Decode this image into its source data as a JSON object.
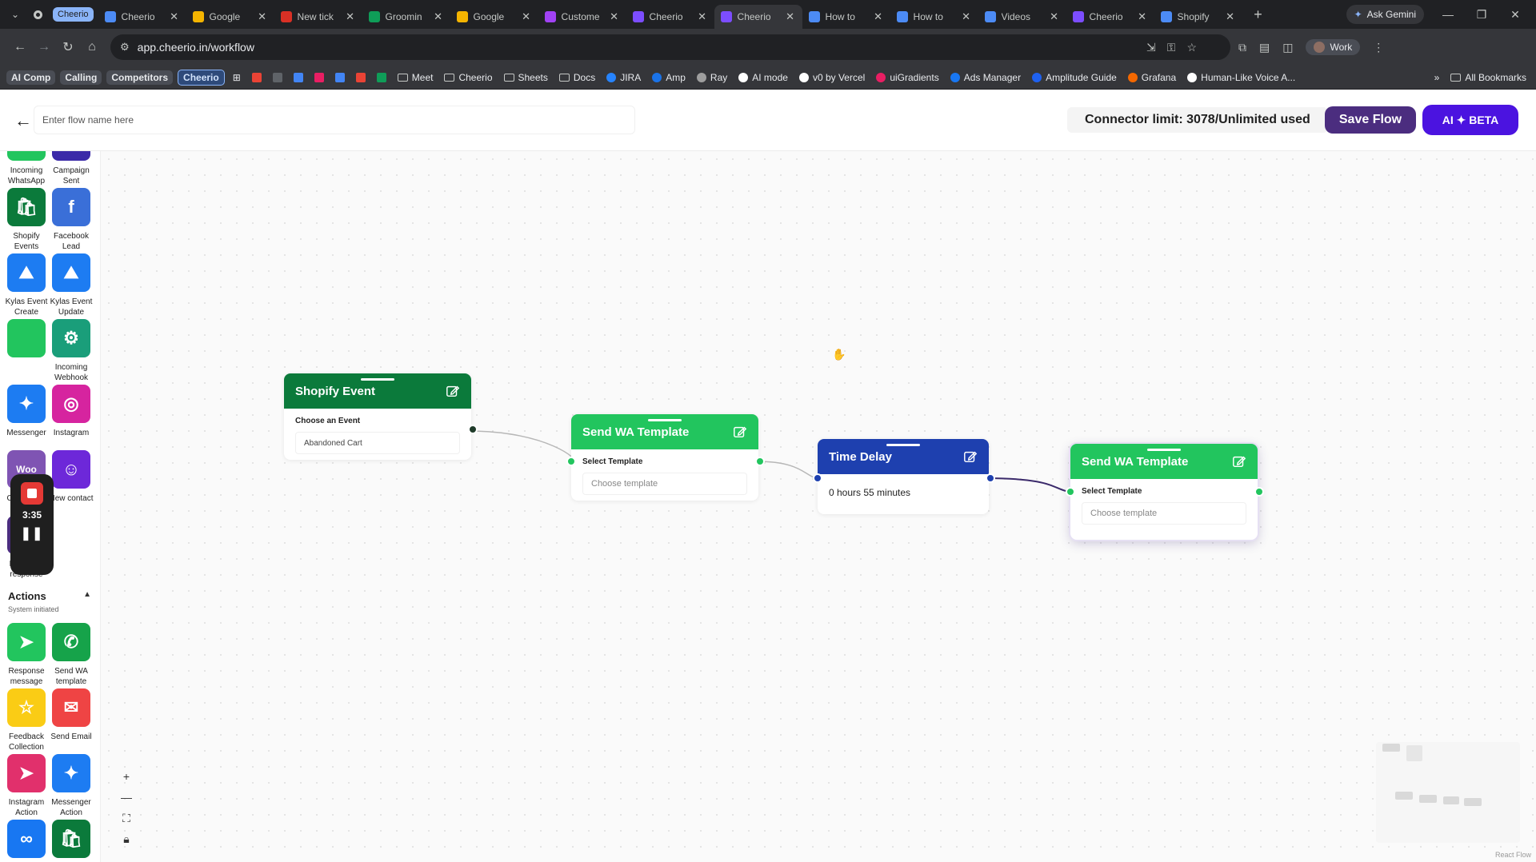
{
  "browser": {
    "group_label": "Cheerio",
    "tabs": [
      {
        "title": "Cheerio",
        "color": "#4c8bf5"
      },
      {
        "title": "Google",
        "color": "#f4b400"
      },
      {
        "title": "New tick",
        "color": "#d93025"
      },
      {
        "title": "Groomin",
        "color": "#0f9d58"
      },
      {
        "title": "Google",
        "color": "#f4b400"
      },
      {
        "title": "Custome",
        "color": "#a142f4"
      },
      {
        "title": "Cheerio",
        "color": "#7c4dff"
      },
      {
        "title": "Cheerio",
        "color": "#7c4dff"
      },
      {
        "title": "How to",
        "color": "#4c8bf5"
      },
      {
        "title": "How to",
        "color": "#4c8bf5"
      },
      {
        "title": "Videos",
        "color": "#4c8bf5"
      },
      {
        "title": "Cheerio",
        "color": "#7c4dff"
      },
      {
        "title": "Shopify",
        "color": "#4c8bf5"
      }
    ],
    "ask_gemini": "Ask Gemini",
    "url": "app.cheerio.in/workflow",
    "profile": "Work",
    "bookmarks": [
      {
        "label": "AI Comp",
        "kind": "chip"
      },
      {
        "label": "Calling",
        "kind": "chip"
      },
      {
        "label": "Competitors",
        "kind": "chip"
      },
      {
        "label": "Cheerio",
        "kind": "chip-blue"
      },
      {
        "label": "",
        "kind": "apps"
      },
      {
        "label": "",
        "kind": "icon",
        "color": "#ea4335"
      },
      {
        "label": "",
        "kind": "icon",
        "color": "#5f6368"
      },
      {
        "label": "",
        "kind": "icon",
        "color": "#4285f4"
      },
      {
        "label": "",
        "kind": "icon",
        "color": "#e91e63"
      },
      {
        "label": "",
        "kind": "icon",
        "color": "#4285f4"
      },
      {
        "label": "",
        "kind": "icon",
        "color": "#ea4335"
      },
      {
        "label": "",
        "kind": "icon",
        "color": "#0f9d58"
      },
      {
        "label": "Meet",
        "kind": "folder"
      },
      {
        "label": "Cheerio",
        "kind": "folder"
      },
      {
        "label": "Sheets",
        "kind": "folder"
      },
      {
        "label": "Docs",
        "kind": "folder"
      },
      {
        "label": "JIRA",
        "kind": "link",
        "color": "#2684ff"
      },
      {
        "label": "Amp",
        "kind": "link",
        "color": "#1a73e8"
      },
      {
        "label": "Ray",
        "kind": "link",
        "color": "#9e9e9e"
      },
      {
        "label": "AI mode",
        "kind": "link",
        "color": "#ffffff"
      },
      {
        "label": "v0 by Vercel",
        "kind": "link",
        "color": "#ffffff"
      },
      {
        "label": "uiGradients",
        "kind": "link",
        "color": "#e91e63"
      },
      {
        "label": "Ads Manager",
        "kind": "link",
        "color": "#1877f2"
      },
      {
        "label": "Amplitude Guide",
        "kind": "link",
        "color": "#1e61f0"
      },
      {
        "label": "Grafana",
        "kind": "link",
        "color": "#f46800"
      },
      {
        "label": "Human-Like Voice A...",
        "kind": "link",
        "color": "#ffffff"
      }
    ],
    "all_bookmarks": "All Bookmarks"
  },
  "header": {
    "flow_name_placeholder": "Enter flow name here",
    "connector_limit": "Connector limit: 3078/Unlimited used",
    "save_label": "Save Flow",
    "ai_label": "AI ✦ BETA"
  },
  "sidebar": {
    "triggers": [
      {
        "label": "Incoming WhatsApp",
        "icon": "whatsapp-icon",
        "color": "#22c55e"
      },
      {
        "label": "Campaign Sent",
        "icon": "campaign-icon",
        "color": "#3b2aa8"
      },
      {
        "label": "Shopify Events",
        "icon": "shopify-icon",
        "color": "#0b7a3b"
      },
      {
        "label": "Facebook Lead",
        "icon": "facebook-icon",
        "color": "#3a6fd8"
      },
      {
        "label": "Kylas Event Create",
        "icon": "kylas-icon",
        "color": "#1d7cf2"
      },
      {
        "label": "Kylas Event Update",
        "icon": "kylas-icon",
        "color": "#1d7cf2"
      },
      {
        "label": "",
        "icon": "hidden-icon",
        "color": "#22c55e"
      },
      {
        "label": "Incoming Webhook",
        "icon": "webhook-icon",
        "color": "#1a9e7a"
      },
      {
        "label": "Messenger",
        "icon": "messenger-icon",
        "color": "#1d7cf2"
      },
      {
        "label": "Instagram",
        "icon": "instagram-icon",
        "color": "#d6249f"
      },
      {
        "label": "Commerce Event",
        "icon": "woo-icon",
        "color": "#7f54b3"
      },
      {
        "label": "New contact",
        "icon": "contact-icon",
        "color": "#6d28d9"
      },
      {
        "label": "New form response",
        "icon": "form-icon",
        "color": "#4b2d7f"
      }
    ],
    "actions_title": "Actions",
    "actions_subtitle": "System initiated",
    "actions": [
      {
        "label": "Response message",
        "icon": "send-icon",
        "color": "#22c55e"
      },
      {
        "label": "Send WA template",
        "icon": "whatsapp-icon",
        "color": "#16a34a"
      },
      {
        "label": "Feedback Collection",
        "icon": "star-icon",
        "color": "#facc15"
      },
      {
        "label": "Send Email",
        "icon": "mail-icon",
        "color": "#ef4444"
      },
      {
        "label": "Instagram Action",
        "icon": "instagram-send-icon",
        "color": "#e1306c"
      },
      {
        "label": "Messenger Action",
        "icon": "messenger-icon",
        "color": "#1d7cf2"
      },
      {
        "label": "",
        "icon": "meta-icon",
        "color": "#1877f2"
      },
      {
        "label": "",
        "icon": "shopify-icon",
        "color": "#0b7a3b"
      }
    ]
  },
  "recorder": {
    "time": "3:35"
  },
  "flow": {
    "nodes": [
      {
        "title": "Shopify Event",
        "color": "#0b7a3b",
        "label": "Choose an Event",
        "value": "Abandoned Cart"
      },
      {
        "title": "Send WA Template",
        "color": "#22c55e",
        "label": "Select Template",
        "placeholder": "Choose template"
      },
      {
        "title": "Time Delay",
        "color": "#1e40af",
        "text": "0 hours 55 minutes"
      },
      {
        "title": "Send WA Template",
        "color": "#22c55e",
        "label": "Select Template",
        "placeholder": "Choose template"
      }
    ]
  },
  "canvas_footer": {
    "attribution": "React Flow"
  }
}
